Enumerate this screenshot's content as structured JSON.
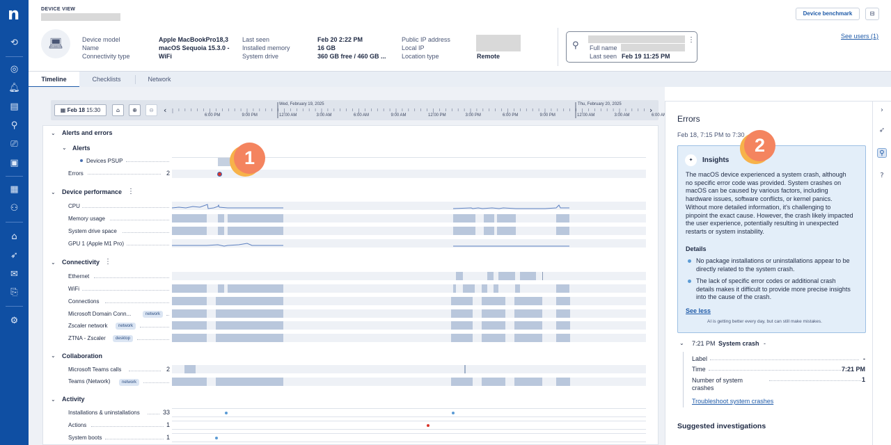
{
  "rail": {
    "icons": [
      "refresh-search-icon",
      "compass-icon",
      "bell-icon",
      "chart-icon",
      "person-search-icon",
      "devices-icon",
      "report-icon",
      "grid-icon",
      "user-search-icon",
      "home-bolt-icon",
      "rocket-icon",
      "chat-icon",
      "book-icon",
      "gear-icon"
    ]
  },
  "header": {
    "section_label": "DEVICE VIEW",
    "device": {
      "labels": [
        "Device model",
        "Name",
        "Connectivity type"
      ],
      "values": [
        "Apple MacBookPro18,3",
        "macOS Sequoia 15.3.0 -",
        "WiFi"
      ]
    },
    "system": {
      "labels": [
        "Last seen",
        "Installed memory",
        "System drive"
      ],
      "values": [
        "Feb 20 2:22 PM",
        "16 GB",
        "360 GB free / 460 GB ..."
      ]
    },
    "network": {
      "labels": [
        "Public IP address",
        "Local IP",
        "Location type"
      ],
      "location_value": "Remote"
    },
    "benchmark_button": "Device benchmark",
    "see_users": "See users (1)",
    "user_card": {
      "full_name_label": "Full name",
      "last_seen_label": "Last seen",
      "last_seen_value": "Feb 19 11:25 PM"
    }
  },
  "tabs": [
    "Timeline",
    "Checklists",
    "Network"
  ],
  "toolbar": {
    "date_chip": "Feb 18",
    "time_chip": "15:30",
    "day_labels": [
      "Wed, February 19, 2025",
      "Thu, February 20, 2025"
    ],
    "ticks": [
      "6:00 PM",
      "9:00 PM",
      "12:00 AM",
      "3:00 AM",
      "6:00 AM",
      "9:00 AM",
      "12:00 PM",
      "3:00 PM",
      "6:00 PM",
      "9:00 PM",
      "12:00 AM",
      "3:00 AM",
      "6:00 AM"
    ]
  },
  "timeline": {
    "alerts_and_errors": "Alerts and errors",
    "alerts": "Alerts",
    "devices_psup": "Devices PSUP",
    "errors": {
      "label": "Errors",
      "count": "2"
    },
    "device_performance": "Device performance",
    "perf_rows": [
      "CPU",
      "Memory usage",
      "System drive space",
      "GPU 1 (Apple M1 Pro)"
    ],
    "connectivity": "Connectivity",
    "conn_rows": [
      "Ethernet",
      "WiFi",
      "Connections",
      "Microsoft Domain Conn...",
      "Zscaler network",
      "ZTNA - Zscaler"
    ],
    "conn_tags": [
      "network",
      "network",
      "desktop"
    ],
    "collaboration": "Collaboration",
    "collab_rows": [
      {
        "label": "Microsoft Teams calls",
        "count": "2"
      },
      {
        "label": "Teams (Network)",
        "tag": "network"
      }
    ],
    "activity": "Activity",
    "activity_rows": [
      {
        "label": "Installations & uninstallations",
        "count": "33"
      },
      {
        "label": "Actions",
        "count": "1"
      },
      {
        "label": "System boots",
        "count": "1"
      }
    ]
  },
  "callouts": [
    "1",
    "2"
  ],
  "errors_panel": {
    "title": "Errors",
    "range": "Feb 18, 7:15 PM to 7:30",
    "insights_title": "Insights",
    "insights_text": "The macOS device experienced a system crash, although no specific error code was provided. System crashes on macOS can be caused by various factors, including hardware issues, software conflicts, or kernel panics. Without more detailed information, it's challenging to pinpoint the exact cause. However, the crash likely impacted the user experience, potentially resulting in unexpected restarts or system instability.",
    "details_title": "Details",
    "details": [
      "No package installations or uninstallations appear to be directly related to the system crash.",
      "The lack of specific error codes or additional crash details makes it difficult to provide more precise insights into the cause of the crash."
    ],
    "see_less": "See less",
    "ai_note": "AI is getting better every day, but can still make mistakes.",
    "event_time": "7:21 PM",
    "event_name": "System crash",
    "event_suffix": "-",
    "fields": [
      {
        "k": "Label",
        "v": "-"
      },
      {
        "k": "Time",
        "v": "7:21 PM"
      },
      {
        "k": "Number of system crashes",
        "v": "1"
      }
    ],
    "troubleshoot_link": "Troubleshoot system crashes",
    "suggested": "Suggested investigations"
  },
  "colors": {
    "rail": "#0f4fa3",
    "accent": "#1e5aa8",
    "track": "#eef1f6",
    "bar": "#b9c7dc",
    "insights_bg": "#e3eef9",
    "callout": "#f4845f",
    "error_dot": "#d9342b"
  }
}
